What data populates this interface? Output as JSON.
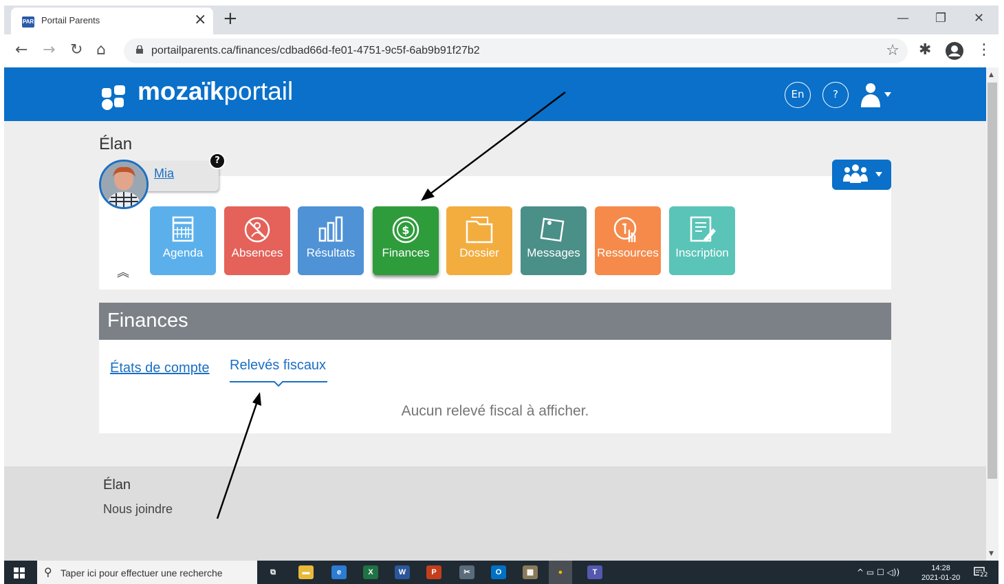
{
  "browser": {
    "tab_title": "Portail Parents",
    "favicon_text": "PAR",
    "url": "portailparents.ca/finances/cdbad66d-fe01-4751-9c5f-6ab9b91f27b2"
  },
  "header": {
    "logo_bold": "mozaïk",
    "logo_light": "portail",
    "lang_button": "En",
    "help_button": "?"
  },
  "student": {
    "school": "Élan",
    "child_name": "Mia",
    "help_badge": "?"
  },
  "tiles": [
    {
      "label": "Agenda",
      "color": "#5bb0ec",
      "icon": "calendar-icon"
    },
    {
      "label": "Absences",
      "color": "#e4625a",
      "icon": "absence-icon"
    },
    {
      "label": "Résultats",
      "color": "#4f92d6",
      "icon": "results-chart-icon"
    },
    {
      "label": "Finances",
      "color": "#2f9c3c",
      "icon": "dollar-icon"
    },
    {
      "label": "Dossier",
      "color": "#f3ad3f",
      "icon": "folder-icon"
    },
    {
      "label": "Messages",
      "color": "#4a8f88",
      "icon": "message-icon"
    },
    {
      "label": "Ressources",
      "color": "#f58a4a",
      "icon": "resources-icon"
    },
    {
      "label": "Inscription",
      "color": "#5ac4b8",
      "icon": "inscription-icon"
    }
  ],
  "finances": {
    "title": "Finances",
    "tabs": [
      "États de compte",
      "Relevés fiscaux"
    ],
    "active_tab": "Relevés fiscaux",
    "empty_message": "Aucun relevé fiscal à afficher."
  },
  "footer": {
    "school": "Élan",
    "contact": "Nous joindre"
  },
  "taskbar": {
    "search_placeholder": "Taper ici pour effectuer une recherche",
    "time": "14:28",
    "date": "2021-01-20",
    "notification_count": "22",
    "apps": [
      {
        "name": "task-view-icon",
        "label": "⧉",
        "color": "#1f2a33"
      },
      {
        "name": "file-explorer-icon",
        "label": "▬",
        "color": "#e8b93a"
      },
      {
        "name": "edge-icon",
        "label": "e",
        "color": "#2b7cd3"
      },
      {
        "name": "excel-icon",
        "label": "X",
        "color": "#1f7244"
      },
      {
        "name": "word-icon",
        "label": "W",
        "color": "#2b579a"
      },
      {
        "name": "powerpoint-icon",
        "label": "P",
        "color": "#c43e1c"
      },
      {
        "name": "snipping-icon",
        "label": "✂",
        "color": "#5a6b7a"
      },
      {
        "name": "outlook-icon",
        "label": "O",
        "color": "#0072c6"
      },
      {
        "name": "photo-app-icon",
        "label": "▦",
        "color": "#8a7a5a"
      },
      {
        "name": "chrome-icon",
        "label": "●",
        "color": "#4a4f55"
      },
      {
        "name": "teams-icon",
        "label": "T",
        "color": "#5558af"
      }
    ]
  }
}
